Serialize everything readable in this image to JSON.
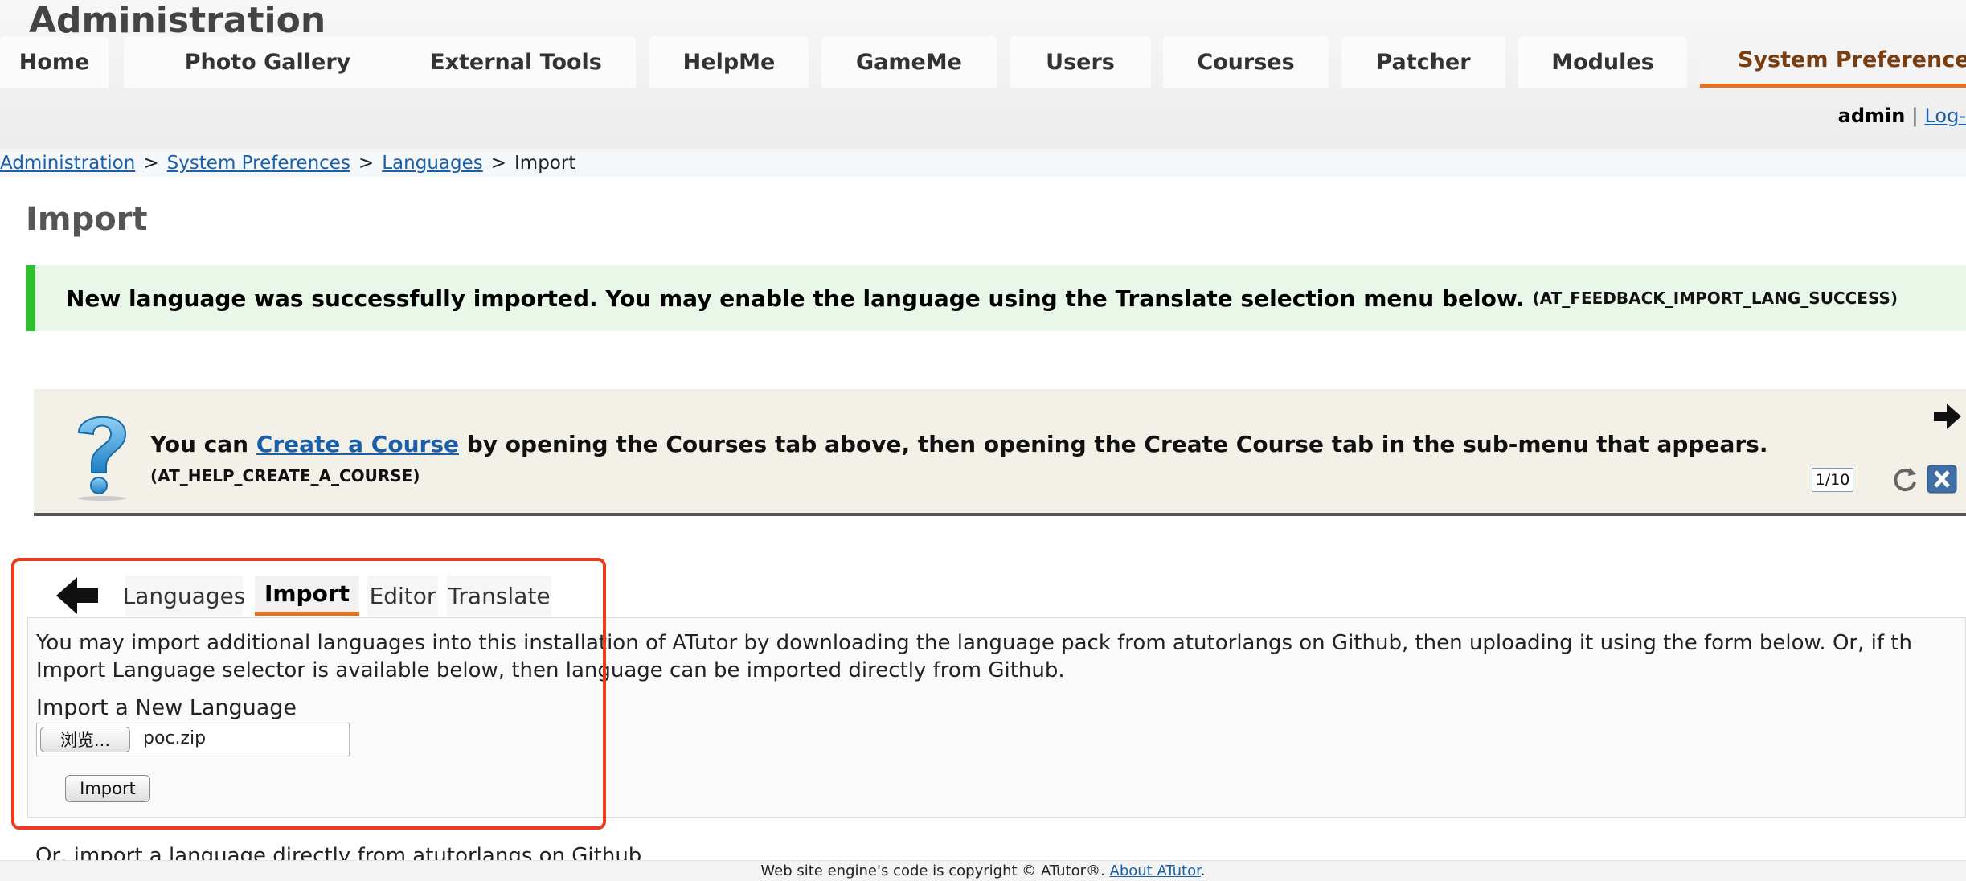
{
  "header": {
    "site_title": "Administration",
    "nav": [
      {
        "label": "Home"
      },
      {
        "label": "Photo Gallery"
      },
      {
        "label": "External Tools"
      },
      {
        "label": "HelpMe"
      },
      {
        "label": "GameMe"
      },
      {
        "label": "Users"
      },
      {
        "label": "Courses"
      },
      {
        "label": "Patcher"
      },
      {
        "label": "Modules"
      },
      {
        "label": "System Preferences",
        "active": true
      }
    ],
    "user": "admin",
    "separator": "|",
    "logout_label": "Log-"
  },
  "breadcrumb": {
    "items": [
      "Administration",
      "System Preferences",
      "Languages"
    ],
    "separator": ">",
    "current": "Import"
  },
  "page_title": "Import",
  "feedback": {
    "message": "New language was successfully imported. You may enable the language using the Translate selection menu below.",
    "code": "(AT_FEEDBACK_IMPORT_LANG_SUCCESS)",
    "accent_color": "#2fbf2f"
  },
  "help": {
    "text_before": "You can ",
    "link": "Create a Course",
    "text_after": " by opening the Courses tab above, then opening the Create Course tab in the sub-menu that appears.",
    "code": "(AT_HELP_CREATE_A_COURSE)",
    "counter": "1/10",
    "icons": [
      "question-icon",
      "next-arrow-icon",
      "refresh-icon",
      "close-icon"
    ]
  },
  "subtabs": [
    {
      "label": "Languages"
    },
    {
      "label": "Import",
      "active": true
    },
    {
      "label": "Editor"
    },
    {
      "label": "Translate"
    }
  ],
  "import_section": {
    "intro_line1": "You may import additional languages into this installation of ATutor by downloading the language pack from atutorlangs on Github, then uploading it using the form below. Or, if th",
    "intro_line2": "Import Language selector is available below, then language can be imported directly from Github.",
    "label": "Import a New Language",
    "browse_label": "浏览...",
    "file_value": "poc.zip",
    "submit_label": "Import"
  },
  "or_text": "Or, import a language directly from atutorlangs on Github",
  "footer": {
    "text": "Web site engine's code is copyright © ATutor®.",
    "link": "About ATutor",
    "end": "."
  },
  "colors": {
    "accent_orange": "#e3711e",
    "link_blue": "#1b5fa8",
    "highlight_red": "#ec3a1f"
  }
}
